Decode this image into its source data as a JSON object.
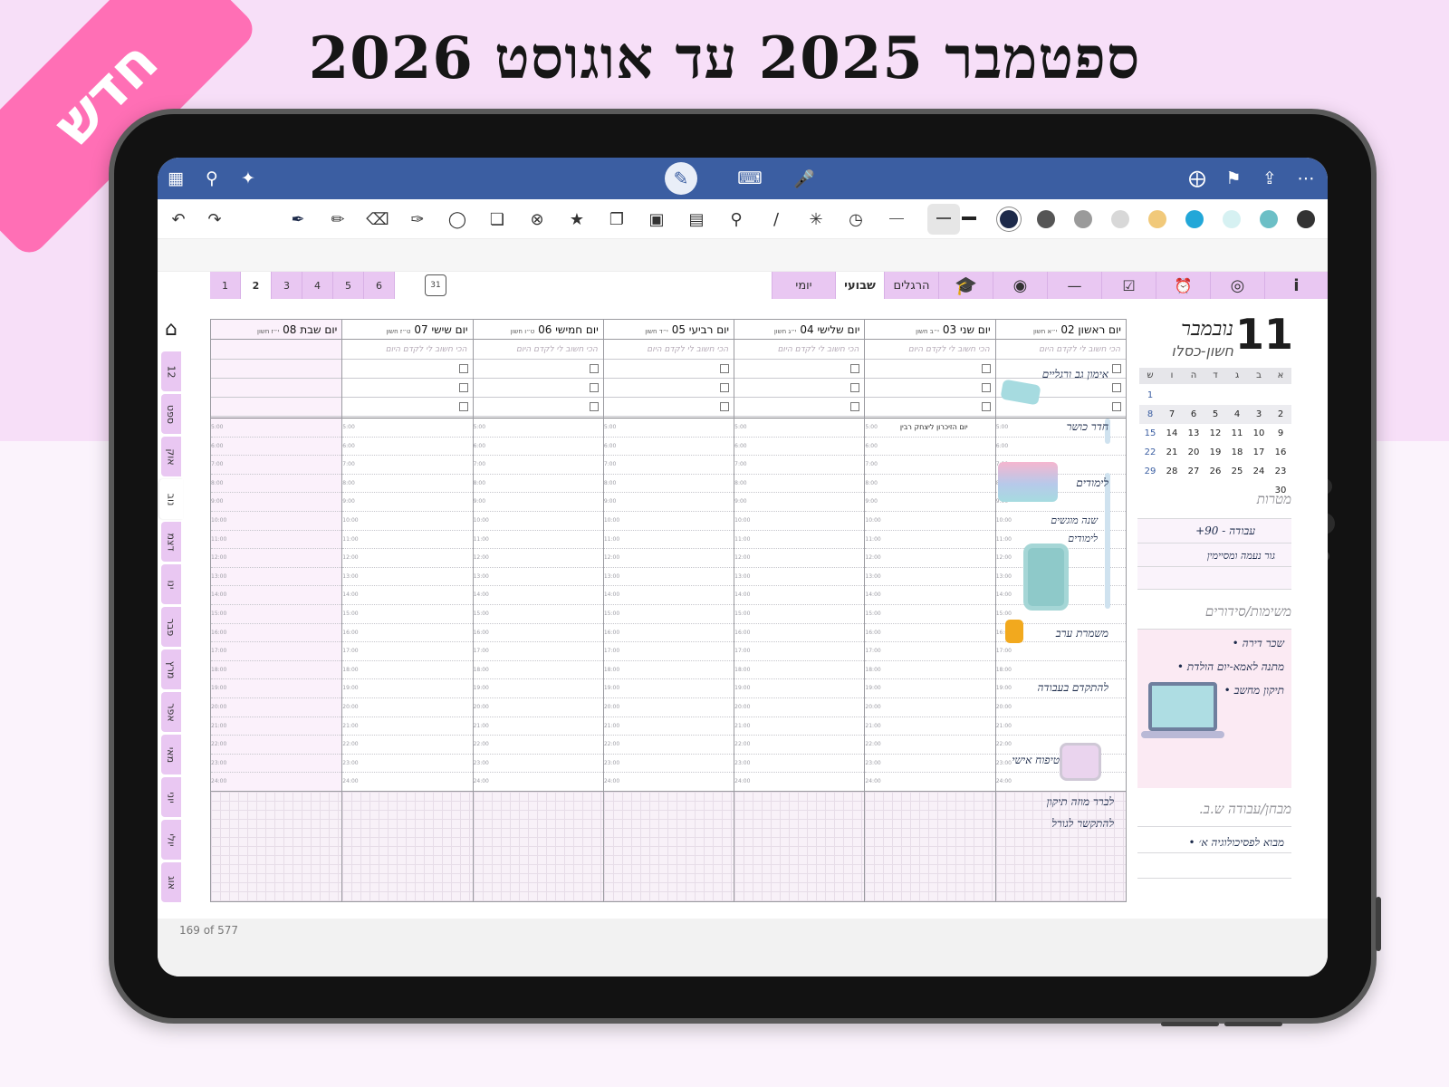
{
  "promo": {
    "headline": "ספטמבר 2025 עד אוגוסט 2026",
    "badge": "חדש"
  },
  "appbar": {
    "icons": [
      "grid-icon",
      "search-icon",
      "sparkle-icon",
      "pen-mode-icon",
      "keyboard-icon",
      "microphone-icon",
      "add-page-icon",
      "bookmark-icon",
      "share-icon",
      "more-icon"
    ]
  },
  "toolbar": {
    "tools": [
      "undo-icon",
      "redo-icon",
      "pen-icon",
      "pencil-icon",
      "eraser-icon",
      "highlighter-icon",
      "shape-icon",
      "elements-icon",
      "lasso-icon",
      "sticker-icon",
      "copy-icon",
      "image-icon",
      "textbox-icon",
      "zoom-icon",
      "ruler-icon",
      "laser-icon",
      "timer-icon"
    ],
    "colors": [
      "#1d2a4a",
      "#555555",
      "#9a9a9a",
      "#d8d8d8",
      "#f1c97a",
      "#22a7d8",
      "#d6f1f2",
      "#6cbfc6",
      "#333333"
    ]
  },
  "tabs": {
    "weeks": [
      "1",
      "2",
      "3",
      "4",
      "5",
      "6"
    ],
    "active_week": "2",
    "calendar_icon_label": "31",
    "views": [
      "יומי",
      "שבועי",
      "הרגלים"
    ],
    "active_view": "שבועי"
  },
  "months": [
    "12",
    "ספט",
    "אוק",
    "נוב",
    "דצמ",
    "ינו",
    "פבר",
    "מרץ",
    "אפר",
    "מאי",
    "יוני",
    "יולי",
    "אוג"
  ],
  "active_month": "נוב",
  "week": {
    "priority_placeholder": "הכי חשוב לי לקדם היום",
    "days": [
      {
        "name": "יום ראשון 02",
        "hebrew": "י״א חשון"
      },
      {
        "name": "יום שני 03",
        "hebrew": "י״ב חשון"
      },
      {
        "name": "יום שלישי 04",
        "hebrew": "י״ג חשון"
      },
      {
        "name": "יום רביעי 05",
        "hebrew": "י״ד חשון"
      },
      {
        "name": "יום חמישי 06",
        "hebrew": "ט״ו חשון"
      },
      {
        "name": "יום שישי 07",
        "hebrew": "ט״ז חשון"
      },
      {
        "name": "יום שבת 08",
        "hebrew": "י״ז חשון"
      }
    ],
    "hours": [
      "5:00",
      "6:00",
      "7:00",
      "8:00",
      "9:00",
      "10:00",
      "11:00",
      "12:00",
      "13:00",
      "14:00",
      "15:00",
      "16:00",
      "17:00",
      "18:00",
      "19:00",
      "20:00",
      "21:00",
      "22:00",
      "23:00",
      "24:00"
    ],
    "event_monday": "יום הזיכרון ליצחק רבין",
    "handwritten_sunday": [
      "אימון גב ורגליים",
      "חדר כושר",
      "לימודים",
      "שנה מוגשים",
      "לימודים",
      "משמרת ערב",
      "להתקדם בעבודה",
      "טיפוח אישי",
      "לברר מוזה תיקון",
      "להתקשר לגורל"
    ]
  },
  "sidebar": {
    "day_number": "11",
    "month_name": "נובמבר",
    "hebrew_month": "חשון-כסלו",
    "weekday_headers": [
      "א",
      "ב",
      "ג",
      "ד",
      "ה",
      "ו",
      "ש"
    ],
    "calendar_rows": [
      [
        "",
        "",
        "",
        "",
        "",
        "",
        "1"
      ],
      [
        "2",
        "3",
        "4",
        "5",
        "6",
        "7",
        "8"
      ],
      [
        "9",
        "10",
        "11",
        "12",
        "13",
        "14",
        "15"
      ],
      [
        "16",
        "17",
        "18",
        "19",
        "20",
        "21",
        "22"
      ],
      [
        "23",
        "24",
        "25",
        "26",
        "27",
        "28",
        "29"
      ],
      [
        "30",
        "",
        "",
        "",
        "",
        "",
        ""
      ]
    ],
    "goals_title": "מטרות",
    "goals": [
      "עבודה - 90+",
      "גור נעמה ומסיימין"
    ],
    "tasks_title": "משימות/סידורים",
    "tasks": [
      "שכר דירה",
      "מתנה לאמא-יום הולדת",
      "תיקון מחשב"
    ],
    "exams_title": "מבחן/עבודה ש.ב.",
    "exams": [
      "מבוא לפסיכולוגיה א׳"
    ]
  },
  "status": {
    "page_counter": "169 of 577"
  }
}
